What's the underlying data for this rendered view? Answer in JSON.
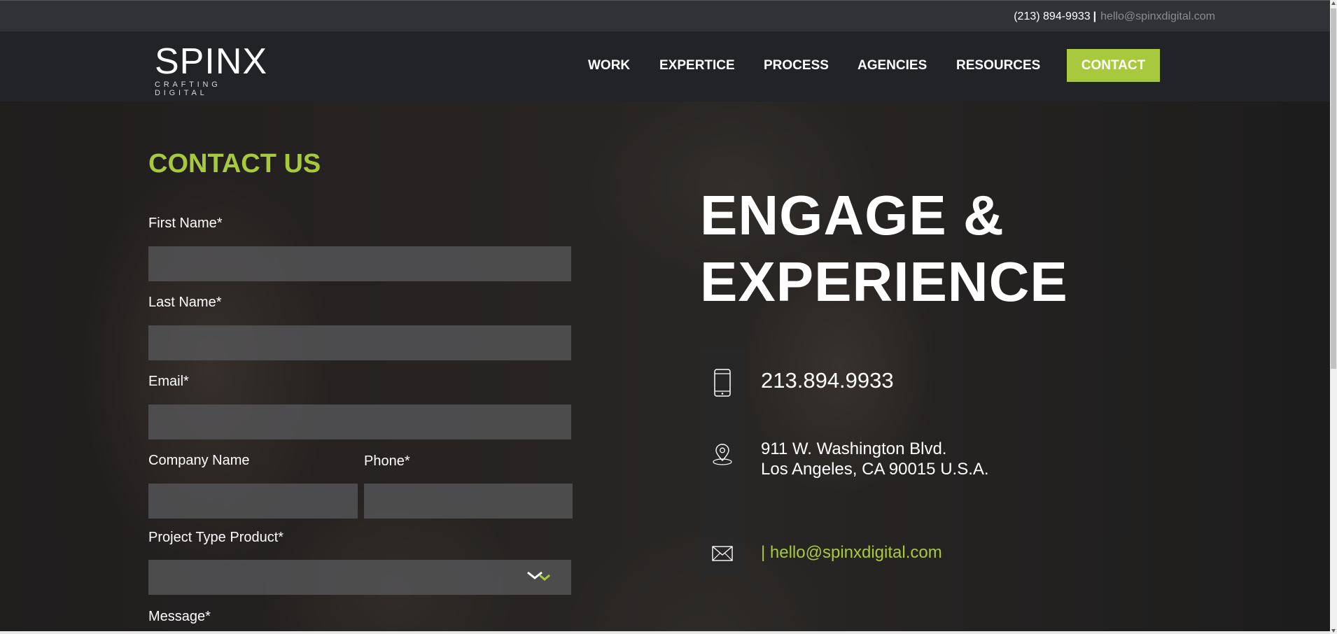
{
  "topbar": {
    "phone": "(213) 894-9933",
    "separator": "|",
    "email": "hello@spinxdigital.com"
  },
  "logo": {
    "wordmark": "SPINX",
    "tagline": "CRAFTING DIGITAL"
  },
  "nav": {
    "items": [
      "WORK",
      "EXPERTICE",
      "PROCESS",
      "AGENCIES",
      "RESOURCES"
    ],
    "cta": "CONTACT"
  },
  "form": {
    "title": "CONTACT US",
    "first_name_label": "First Name*",
    "last_name_label": "Last Name*",
    "email_label": "Email*",
    "company_label": "Company Name",
    "phone_label": "Phone*",
    "project_label": "Project Type Product*",
    "message_label": "Message*"
  },
  "engage": {
    "line1": "ENGAGE &",
    "line2": "EXPERIENCE",
    "phone": "213.894.9933",
    "address_line1": "911 W. Washington Blvd.",
    "address_line2": "Los Angeles, CA 90015 U.S.A.",
    "email": "| hello@spinxdigital.com"
  },
  "colors": {
    "accent": "#a8c93e",
    "topbar_bg": "#303236",
    "navbar_bg": "#222327"
  }
}
